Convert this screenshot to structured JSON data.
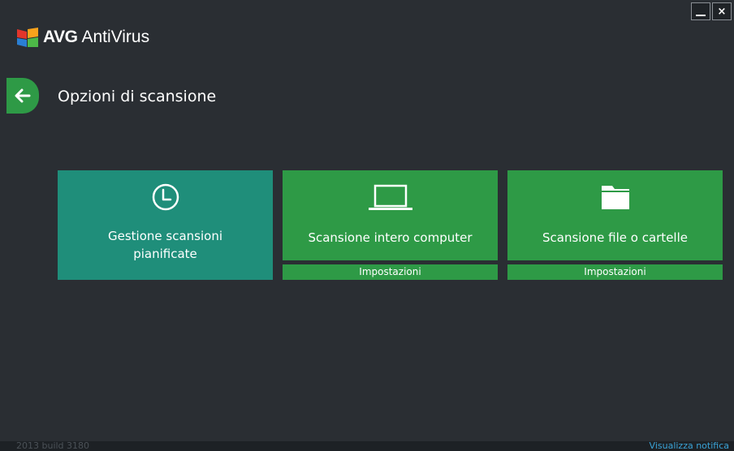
{
  "window": {
    "minimize_icon": "minimize-icon",
    "close_glyph": "×"
  },
  "app": {
    "brand": "AVG",
    "product": "AntiVirus"
  },
  "page": {
    "title": "Opzioni di scansione"
  },
  "tiles": [
    {
      "label_line1": "Gestione scansioni",
      "label_line2": "pianificate",
      "icon": "clock-icon",
      "color": "#1f8e7a"
    },
    {
      "label": "Scansione intero computer",
      "icon": "laptop-icon",
      "settings": "Impostazioni",
      "color": "#2e9a46"
    },
    {
      "label": "Scansione file o cartelle",
      "icon": "folder-icon",
      "settings": "Impostazioni",
      "color": "#2e9a46"
    }
  ],
  "footer": {
    "build": "2013  build 3180",
    "notify_link": "Visualizza notifica"
  },
  "colors": {
    "background": "#2a2e33",
    "accent_green": "#2e9a46",
    "teal": "#1f8e7a",
    "link": "#3aa3d7"
  }
}
